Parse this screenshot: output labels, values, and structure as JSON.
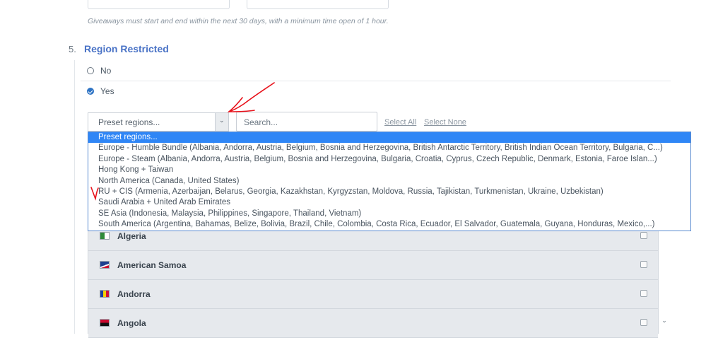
{
  "form": {
    "date_hint": "Giveaways must start and end within the next 30 days, with a minimum time open of 1 hour.",
    "section_number": "5.",
    "section_title": "Region Restricted",
    "option_no": "No",
    "option_yes": "Yes",
    "selected_option": "Yes"
  },
  "controls": {
    "preset_select_value": "Preset regions...",
    "search_placeholder": "Search...",
    "select_all_label": "Select All",
    "select_none_label": "Select None"
  },
  "dropdown": {
    "selected_index": 0,
    "options": [
      "Preset regions...",
      "Europe - Humble Bundle (Albania, Andorra, Austria, Belgium, Bosnia and Herzegovina, British Antarctic Territory, British Indian Ocean Territory, Bulgaria, C...)",
      "Europe - Steam (Albania, Andorra, Austria, Belgium, Bosnia and Herzegovina, Bulgaria, Croatia, Cyprus, Czech Republic, Denmark, Estonia, Faroe Islan...)",
      "Hong Kong + Taiwan",
      "North America (Canada, United States)",
      "RU + CIS (Armenia, Azerbaijan, Belarus, Georgia, Kazakhstan, Kyrgyzstan, Moldova, Russia, Tajikistan, Turkmenistan, Ukraine, Uzbekistan)",
      "Saudi Arabia + United Arab Emirates",
      "SE Asia (Indonesia, Malaysia, Philippines, Singapore, Thailand, Vietnam)",
      "South America (Argentina, Bahamas, Belize, Bolivia, Brazil, Chile, Colombia, Costa Rica, Ecuador, El Salvador, Guatemala, Guyana, Honduras, Mexico,...)"
    ]
  },
  "countries": [
    {
      "name": "Algeria",
      "flag_icon": "algeria-flag-icon",
      "checked": false
    },
    {
      "name": "American Samoa",
      "flag_icon": "american-samoa-flag-icon",
      "checked": false
    },
    {
      "name": "Andorra",
      "flag_icon": "andorra-flag-icon",
      "checked": false
    },
    {
      "name": "Angola",
      "flag_icon": "angola-flag-icon",
      "checked": false
    }
  ],
  "colors": {
    "accent": "#4a73c6",
    "highlight": "#2f86f6",
    "annotation": "#e8121b"
  }
}
